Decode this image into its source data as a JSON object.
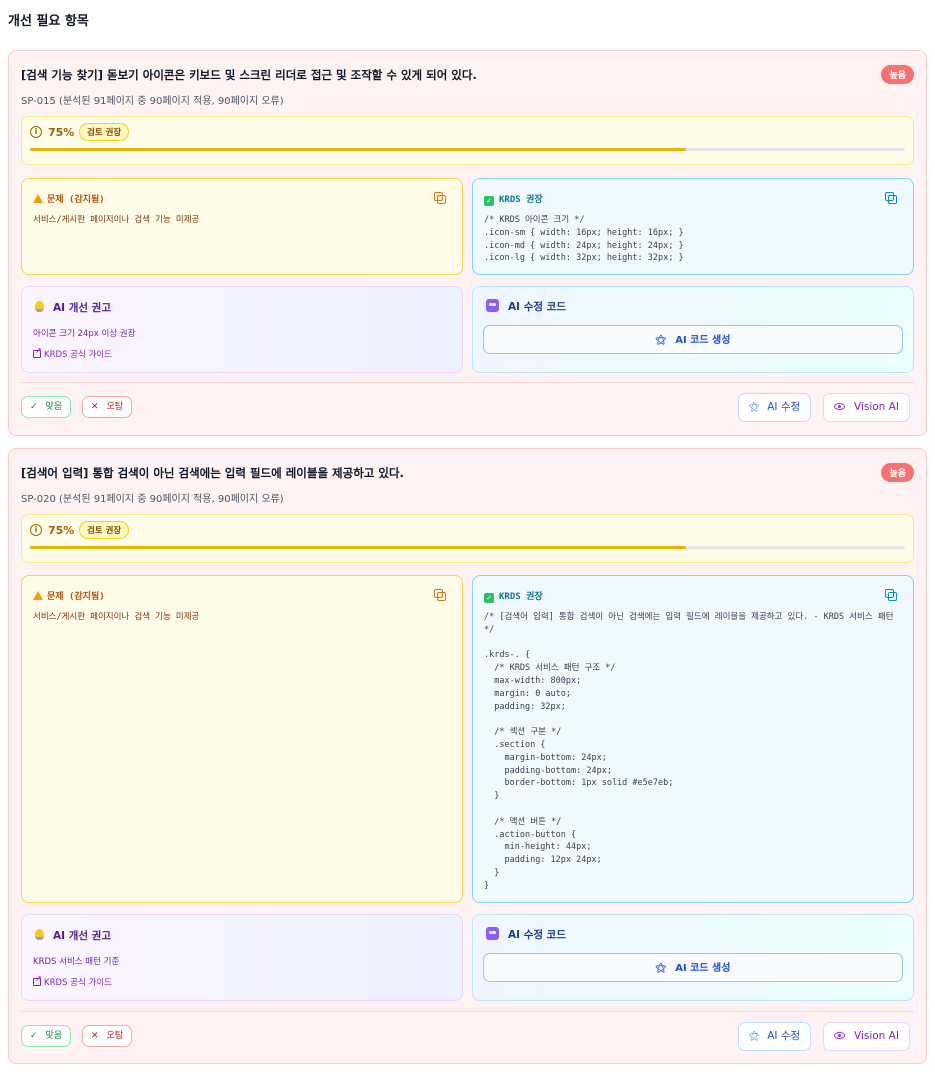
{
  "page": {
    "section_title": "개선 필요 항목"
  },
  "issues": [
    {
      "title": "[검색 기능 찾기] 돋보기 아이콘은 키보드 및 스크린 리더로 접근 및 조작할 수 있게 되어 있다.",
      "severity": "높음",
      "meta": "SP-015 (분석된 91페이지 중 90페이지 적용, 90페이지 오류)",
      "confidence": {
        "label": "75%",
        "value": 0.75,
        "tag": "검토 권장"
      },
      "problem": {
        "header": "문제 (감지됨)",
        "text": "서비스/게시판 페이지이나 검색 기능 미제공"
      },
      "krds": {
        "header": "KRDS 권장",
        "code": "/* KRDS 아이콘 크기 */\n.icon-sm { width: 16px; height: 16px; }\n.icon-md { width: 24px; height: 24px; }\n.icon-lg { width: 32px; height: 32px; }"
      },
      "advice": {
        "header": "AI 개선 권고",
        "text": "아이콘 크기 24px 이상 권장",
        "link": "KRDS 공식 가이드"
      },
      "ai_code": {
        "header": "AI 수정 코드",
        "button": "AI 코드 생성"
      },
      "actions": {
        "ok": "맞음",
        "wrong": "오탐",
        "ai_fix": "AI 수정",
        "vision": "Vision AI"
      }
    },
    {
      "title": "[검색어 입력] 통합 검색이 아닌 검색에는 입력 필드에 레이블을 제공하고 있다.",
      "severity": "높음",
      "meta": "SP-020 (분석된 91페이지 중 90페이지 적용, 90페이지 오류)",
      "confidence": {
        "label": "75%",
        "value": 0.75,
        "tag": "검토 권장"
      },
      "problem": {
        "header": "문제 (감지됨)",
        "text": "서비스/게시판 페이지이나 검색 기능 미제공"
      },
      "krds": {
        "header": "KRDS 권장",
        "code": "/* [검색어 입력] 통합 검색이 아닌 검색에는 입력 필드에 레이블을 제공하고 있다. - KRDS 서비스 패턴 */\n\n.krds-. {\n  /* KRDS 서비스 패턴 구조 */\n  max-width: 800px;\n  margin: 0 auto;\n  padding: 32px;\n\n  /* 섹션 구분 */\n  .section {\n    margin-bottom: 24px;\n    padding-bottom: 24px;\n    border-bottom: 1px solid #e5e7eb;\n  }\n\n  /* 액션 버튼 */\n  .action-button {\n    min-height: 44px;\n    padding: 12px 24px;\n  }\n}"
      },
      "advice": {
        "header": "AI 개선 권고",
        "text": "KRDS 서비스 패턴 기준",
        "link": "KRDS 공식 가이드"
      },
      "ai_code": {
        "header": "AI 수정 코드",
        "button": "AI 코드 생성"
      },
      "actions": {
        "ok": "맞음",
        "wrong": "오탐",
        "ai_fix": "AI 수정",
        "vision": "Vision AI"
      }
    }
  ]
}
